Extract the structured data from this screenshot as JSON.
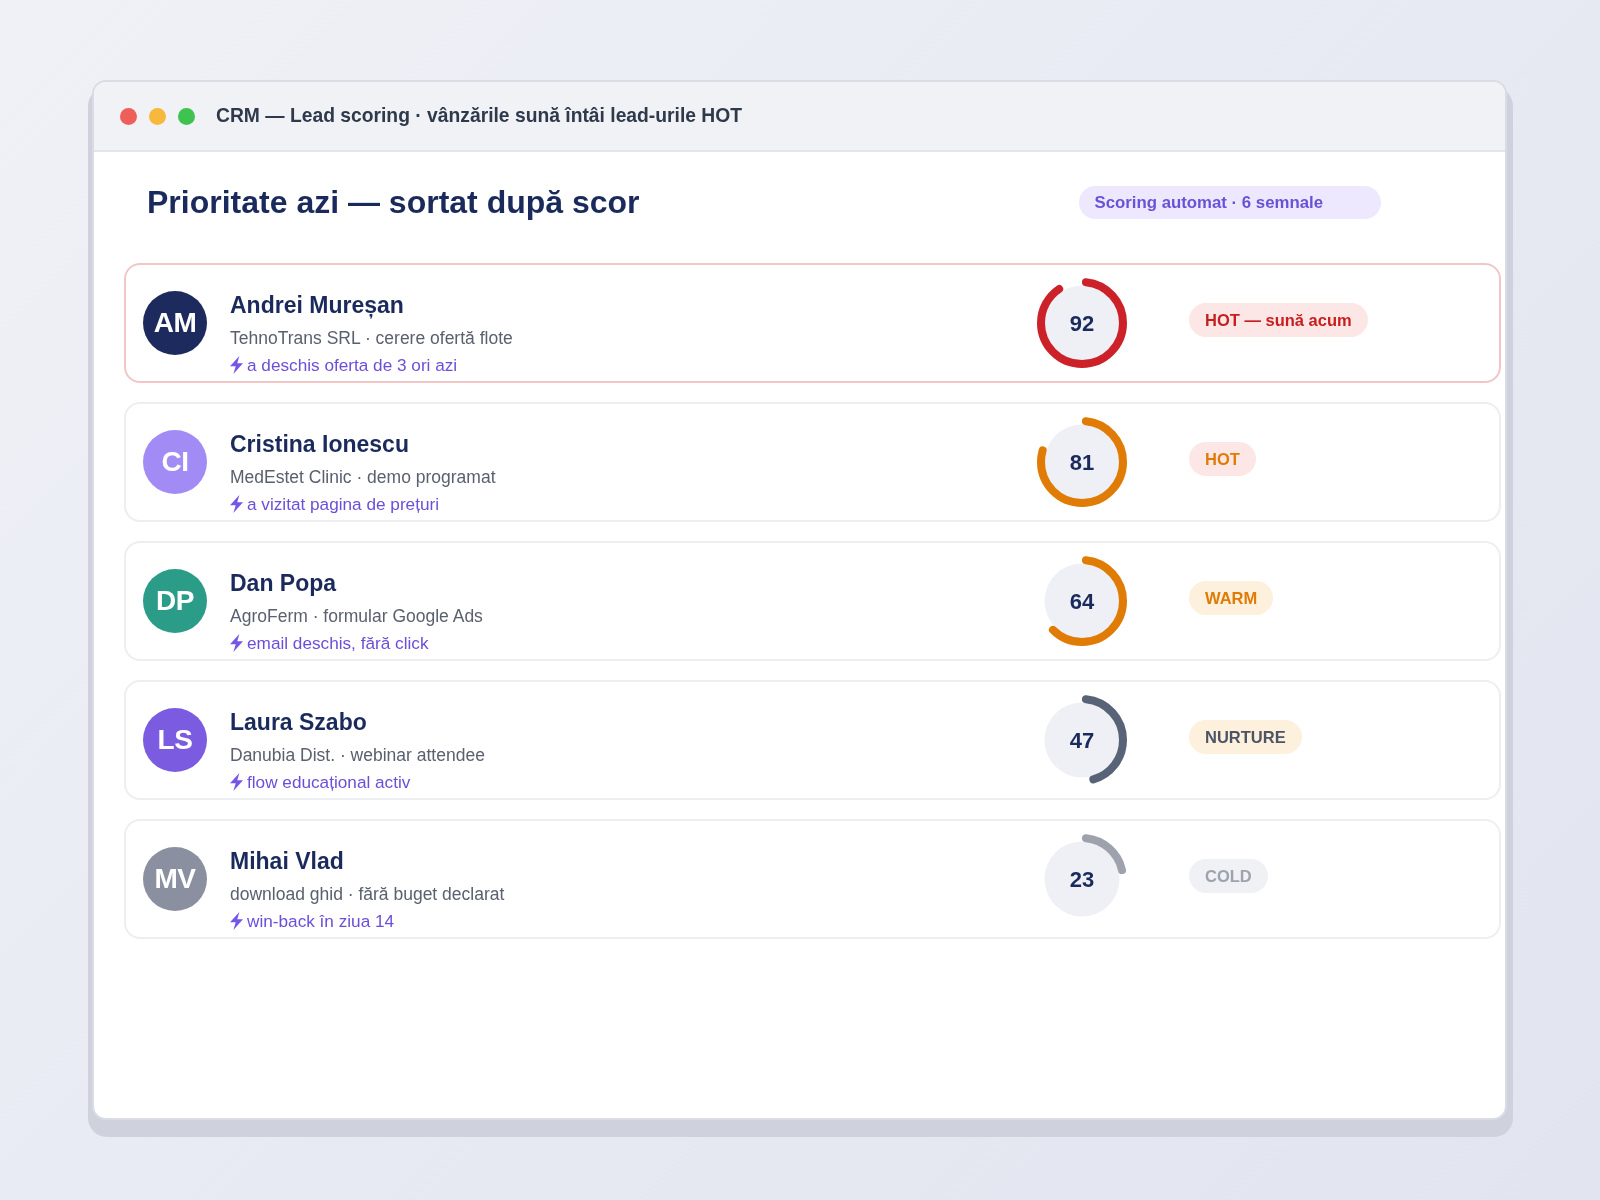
{
  "window": {
    "title": "CRM — Lead scoring · vânzările sună întâi lead-urile HOT"
  },
  "header": {
    "title": "Prioritate azi — sortat după scor",
    "badge": "Scoring automat · 6 semnale"
  },
  "leads": [
    {
      "highlighted": true,
      "avatar": {
        "initials": "AM",
        "color": "#1c2a5e"
      },
      "name": "Andrei Mureșan",
      "details": "TehnoTrans SRL · cerere ofertă flote",
      "signal": "a deschis oferta de 3 ori azi",
      "score": {
        "value": "92",
        "level": 0.92,
        "color": "#cc2128"
      },
      "badge": {
        "label": "HOT — sună acum",
        "kind": "hot",
        "color": "#c81e1e"
      }
    },
    {
      "highlighted": false,
      "avatar": {
        "initials": "CI",
        "color": "#a38bf6"
      },
      "name": "Cristina Ionescu",
      "details": "MedEstet Clinic · demo programat",
      "signal": "a vizitat pagina de prețuri",
      "score": {
        "value": "81",
        "level": 0.81,
        "color": "#e07b06"
      },
      "badge": {
        "label": "HOT",
        "kind": "hot",
        "color": "#e07b06"
      }
    },
    {
      "highlighted": false,
      "avatar": {
        "initials": "DP",
        "color": "#2a9c88"
      },
      "name": "Dan Popa",
      "details": "AgroFerm · formular Google Ads",
      "signal": "email deschis, fără click",
      "score": {
        "value": "64",
        "level": 0.64,
        "color": "#e07b06"
      },
      "badge": {
        "label": "WARM",
        "kind": "warm",
        "color": "#e07b06"
      }
    },
    {
      "highlighted": false,
      "avatar": {
        "initials": "LS",
        "color": "#7b5ce1"
      },
      "name": "Laura Szabo",
      "details": "Danubia Dist. · webinar attendee",
      "signal": "flow educațional activ",
      "score": {
        "value": "47",
        "level": 0.47,
        "color": "#596377"
      },
      "badge": {
        "label": "NURTURE",
        "kind": "warm",
        "color": "#4b5563"
      }
    },
    {
      "highlighted": false,
      "avatar": {
        "initials": "MV",
        "color": "#8a909f"
      },
      "name": "Mihai Vlad",
      "details": "download ghid · fără buget declarat",
      "signal": "win-back în ziua 14",
      "score": {
        "value": "23",
        "level": 0.23,
        "color": "#9da2ac"
      },
      "badge": {
        "label": "COLD",
        "kind": "cold",
        "color": "#9ca3af"
      }
    }
  ]
}
